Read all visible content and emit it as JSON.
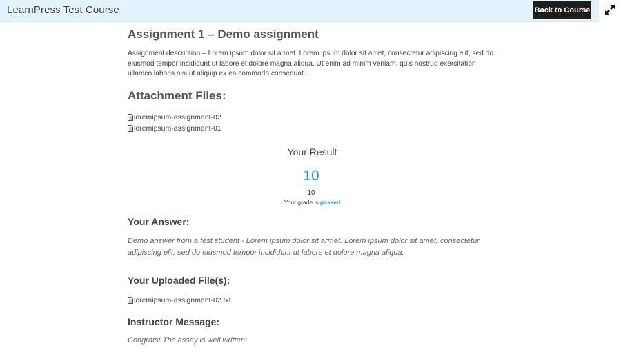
{
  "header": {
    "course_title": "LearnPress Test Course",
    "back_button_label": "Back to Course",
    "fullscreen_icon": "expand-arrows-icon"
  },
  "assignment": {
    "title": "Assignment 1 – Demo assignment",
    "description": "Assignment description – Lorem ipsum dolor sit armet. Lorem ipsum dolor sit amet, consectetur adipiscing elit, sed do eiusmod tempor incididunt ut labore et dolore magna aliqua. Ut enim ad minim veniam, quis nostrud exercitation ullamco laboris nisi ut aliquip ex ea commodo consequat.",
    "attachments_heading": "Attachment Files:",
    "attachments": [
      {
        "name": "loremipsum-assignment-02"
      },
      {
        "name": "loremipsum-assignment-01"
      }
    ]
  },
  "result": {
    "label": "Your Result",
    "score": "10",
    "total": "10",
    "grade_prefix": "Your grade is",
    "grade_status": "passed",
    "accent_color": "#2b96d1"
  },
  "answer": {
    "heading": "Your Answer:",
    "text": "Demo answer from a test student - Lorem ipsum dolor sit armet. Lorem ipsum dolor sit amet, consectetur adipiscing elit, sed do eiusmod tempor incididunt ut labore et dolore magna aliqua."
  },
  "uploaded": {
    "heading": "Your Uploaded File(s):",
    "files": [
      {
        "name": "loremipsum-assignment-02.txt"
      }
    ]
  },
  "instructor": {
    "heading": "Instructor Message:",
    "message": "Congrats! The essay is well written!"
  }
}
